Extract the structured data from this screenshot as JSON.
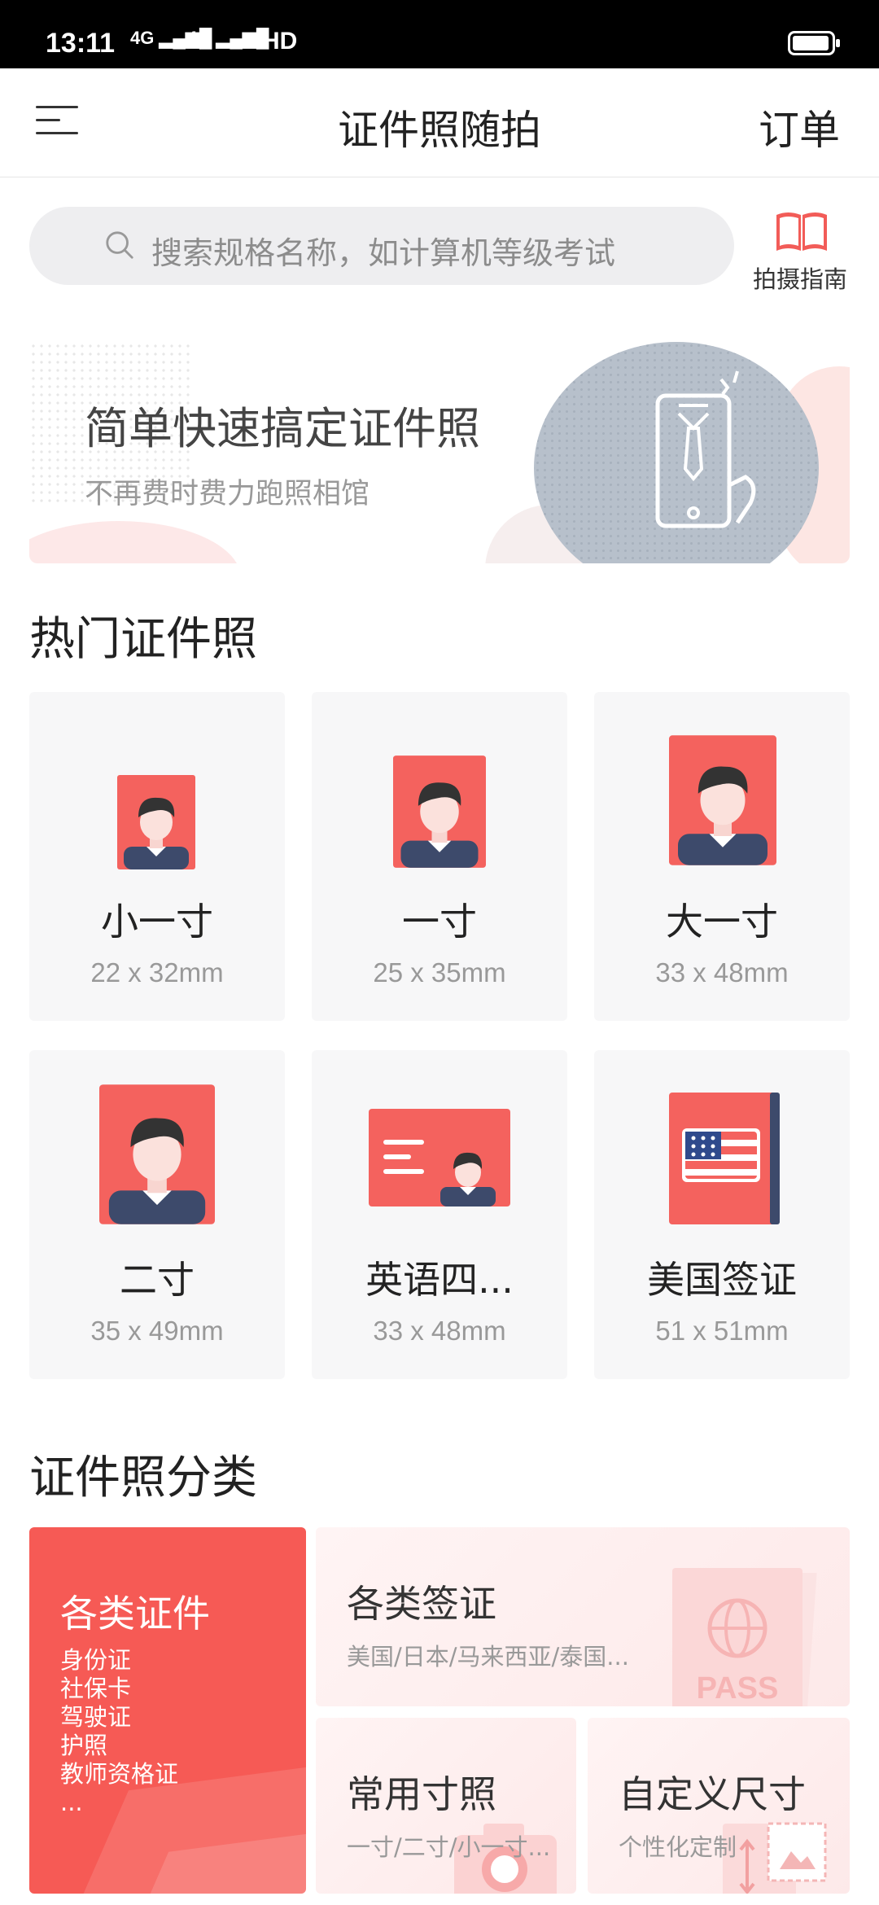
{
  "status_bar": {
    "time": "13:11",
    "net1": "4G",
    "net2": "4G",
    "hd": "HD"
  },
  "header": {
    "title": "证件照随拍",
    "orders_label": "订单"
  },
  "search": {
    "placeholder": "搜索规格名称，如计算机等级考试",
    "guide_label": "拍摄指南"
  },
  "banner": {
    "headline": "简单快速搞定证件照",
    "subline": "不再费时费力跑照相馆"
  },
  "hot": {
    "title": "热门证件照",
    "items": [
      {
        "name": "小一寸",
        "size": "22 x 32mm",
        "icon": "portrait-photo-icon"
      },
      {
        "name": "一寸",
        "size": "25 x 35mm",
        "icon": "portrait-photo-icon"
      },
      {
        "name": "大一寸",
        "size": "33 x 48mm",
        "icon": "portrait-photo-icon"
      },
      {
        "name": "二寸",
        "size": "35 x 49mm",
        "icon": "portrait-photo-icon"
      },
      {
        "name": "英语四...",
        "size": "33 x 48mm",
        "icon": "id-card-icon"
      },
      {
        "name": "美国签证",
        "size": "51 x 51mm",
        "icon": "us-passport-icon"
      }
    ]
  },
  "categories": {
    "title": "证件照分类",
    "main": {
      "title": "各类证件",
      "items": [
        "身份证",
        "社保卡",
        "驾驶证",
        "护照",
        "教师资格证",
        "..."
      ]
    },
    "visa": {
      "title": "各类签证",
      "desc": "美国/日本/马来西亚/泰国...",
      "icon_text": "PASS"
    },
    "common": {
      "title": "常用寸照",
      "desc": "一寸/二寸/小一寸..."
    },
    "custom": {
      "title": "自定义尺寸",
      "desc": "个性化定制"
    }
  },
  "colors": {
    "accent": "#f65a55",
    "icon_red": "#f4625e",
    "navy": "#3d4a6b"
  }
}
